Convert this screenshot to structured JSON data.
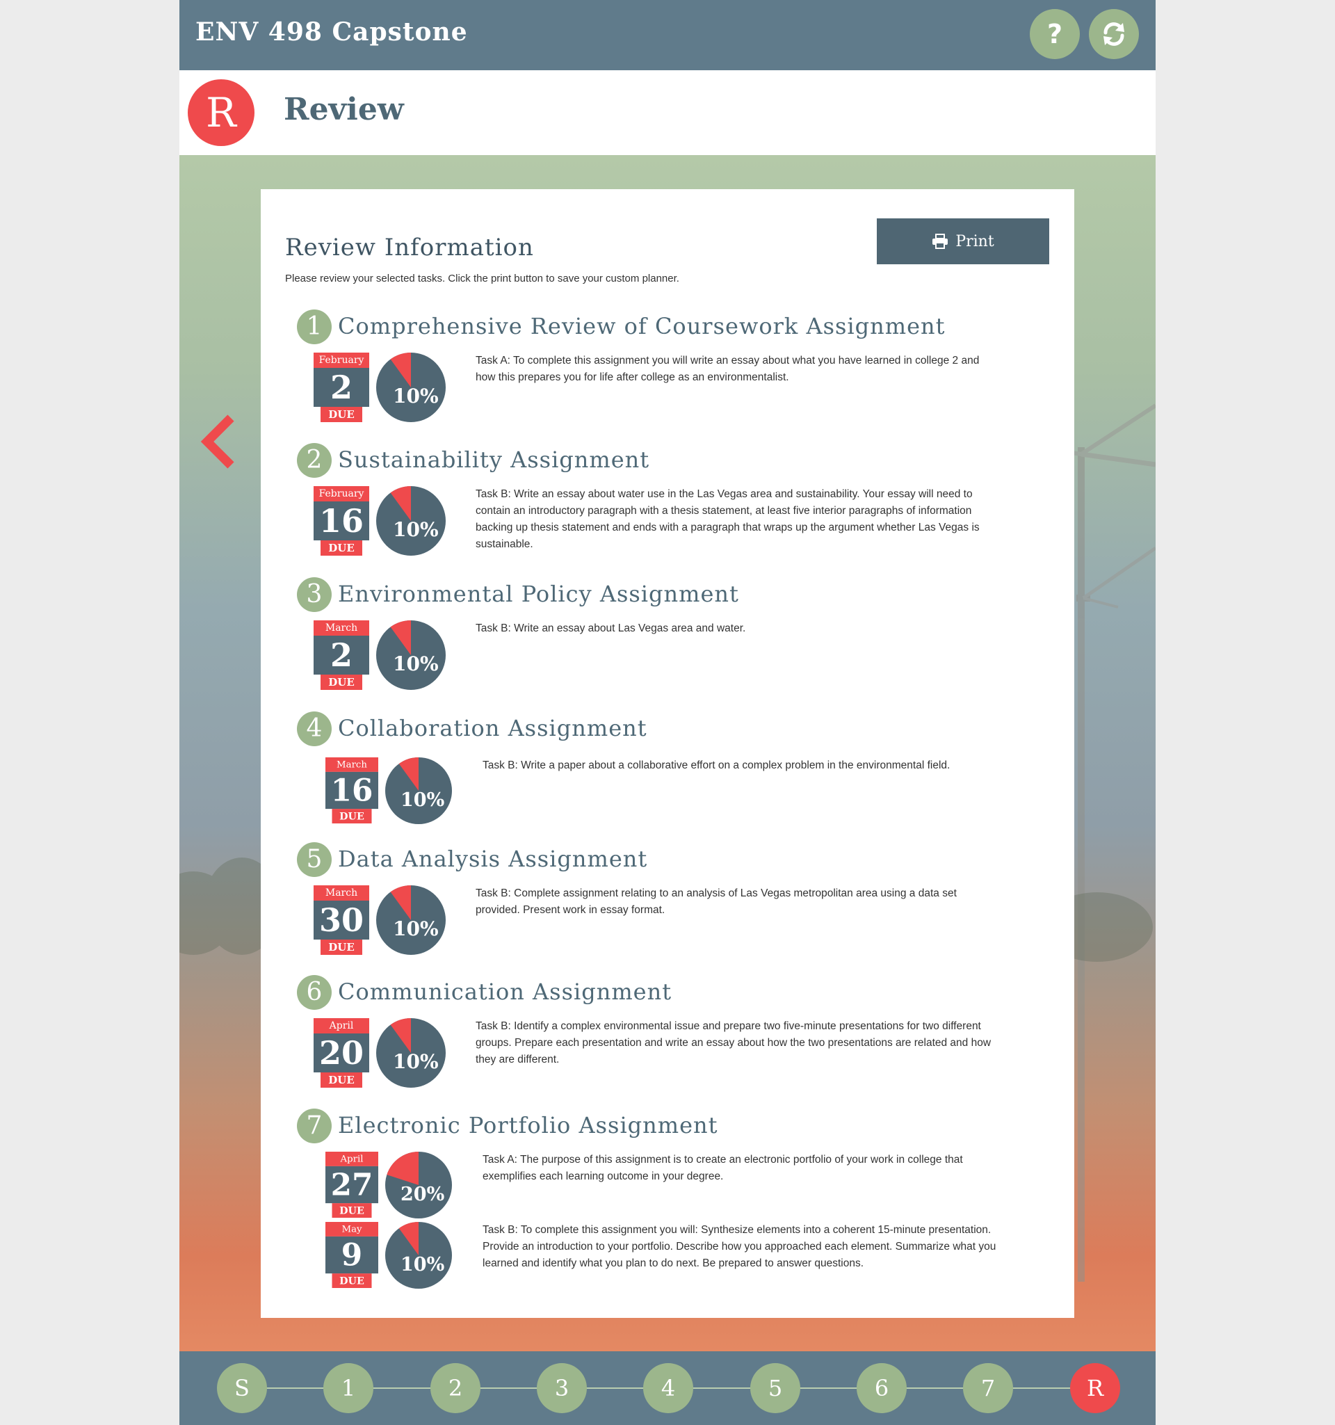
{
  "header": {
    "course_title": "ENV 498 Capstone",
    "help_icon": "question-icon",
    "refresh_icon": "refresh-icon"
  },
  "section": {
    "badge": "R",
    "title": "Review"
  },
  "card": {
    "title": "Review Information",
    "description": "Please review your selected tasks. Click the print button to save your custom planner.",
    "print_label": "Print",
    "print_icon": "printer-icon"
  },
  "assignments": [
    {
      "number": "1",
      "title": "Comprehensive Review of Coursework Assignment",
      "tasks": [
        {
          "month": "February",
          "day": "2",
          "due": "DUE",
          "weight": "10%",
          "weight_fraction": 0.1,
          "text": "Task A: To complete this assignment you will write an essay about what you have learned in college 2 and how this prepares you for life after college as an environmentalist."
        }
      ]
    },
    {
      "number": "2",
      "title": "Sustainability Assignment",
      "tasks": [
        {
          "month": "February",
          "day": "16",
          "due": "DUE",
          "weight": "10%",
          "weight_fraction": 0.1,
          "text": "Task B: Write an essay about water use in the Las Vegas area and sustainability. Your essay will need to contain an introductory paragraph with a thesis statement, at least five interior paragraphs of information backing up thesis statement and ends with a paragraph that wraps up the argument whether Las Vegas is sustainable."
        }
      ]
    },
    {
      "number": "3",
      "title": "Environmental Policy Assignment",
      "tasks": [
        {
          "month": "March",
          "day": "2",
          "due": "DUE",
          "weight": "10%",
          "weight_fraction": 0.1,
          "text": "Task B: Write an essay about Las Vegas area and water."
        }
      ]
    },
    {
      "number": "4",
      "title": "Collaboration Assignment",
      "tasks": [
        {
          "month": "March",
          "day": "16",
          "due": "DUE",
          "weight": "10%",
          "weight_fraction": 0.1,
          "text": "Task B: Write a paper about a collaborative effort on a complex problem in the environmental field."
        }
      ]
    },
    {
      "number": "5",
      "title": "Data Analysis Assignment",
      "tasks": [
        {
          "month": "March",
          "day": "30",
          "due": "DUE",
          "weight": "10%",
          "weight_fraction": 0.1,
          "text": "Task B: Complete assignment relating to an analysis of Las Vegas metropolitan area using a data set provided. Present work in essay format."
        }
      ]
    },
    {
      "number": "6",
      "title": "Communication Assignment",
      "tasks": [
        {
          "month": "April",
          "day": "20",
          "due": "DUE",
          "weight": "10%",
          "weight_fraction": 0.1,
          "text": "Task B: Identify a complex environmental issue and prepare two five-minute presentations for two different groups. Prepare each presentation and write an essay about how the two presentations are related and how they are different."
        }
      ]
    },
    {
      "number": "7",
      "title": "Electronic Portfolio Assignment",
      "tasks": [
        {
          "month": "April",
          "day": "27",
          "due": "DUE",
          "weight": "20%",
          "weight_fraction": 0.2,
          "text": "Task A: The purpose of this assignment is to create an electronic portfolio of your work in college that exemplifies each learning outcome in your degree."
        },
        {
          "month": "May",
          "day": "9",
          "due": "DUE",
          "weight": "10%",
          "weight_fraction": 0.1,
          "text": "Task B: To complete this assignment you will: Synthesize elements into a coherent 15-minute presentation. Provide an introduction to your portfolio. Describe how you approached each element. Summarize what you learned and identify what you plan to do next. Be prepared to answer questions."
        }
      ]
    }
  ],
  "nav": {
    "back_icon": "chevron-left-icon",
    "steps": [
      "S",
      "1",
      "2",
      "3",
      "4",
      "5",
      "6",
      "7",
      "R"
    ],
    "active_step": "R"
  },
  "colors": {
    "header_bg": "#607b8b",
    "accent_red": "#ef4a4c",
    "accent_green": "#9cb68c",
    "pie_dark": "#4f6673"
  }
}
